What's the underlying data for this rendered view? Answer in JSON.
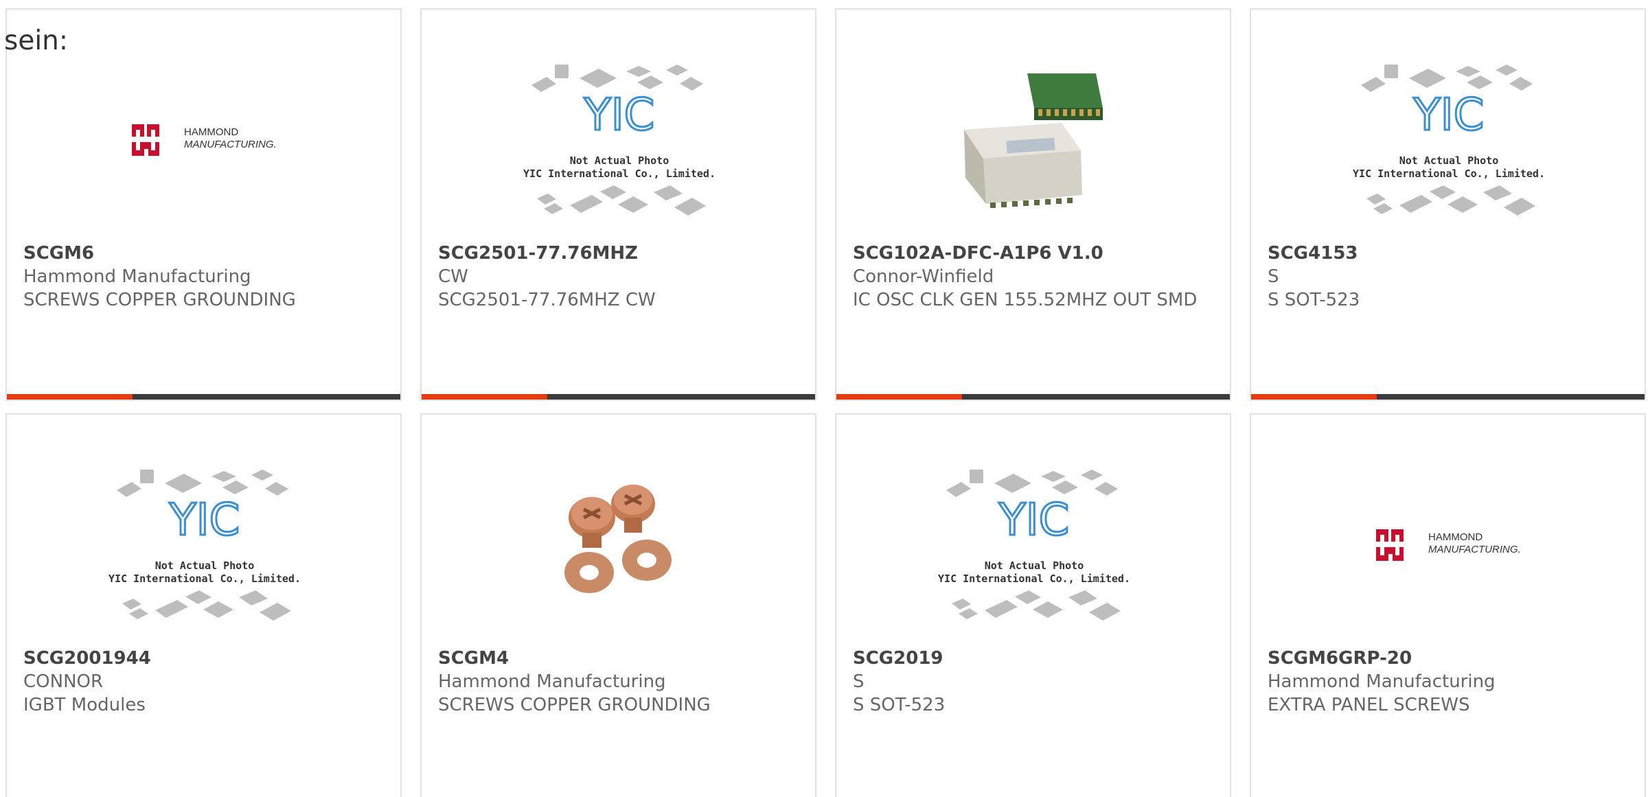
{
  "intro": {
    "text": "sein:"
  },
  "colors": {
    "accent": "#e23d12",
    "bar": "#3b3b3b",
    "logo_red": "#c8102e",
    "yic_blue": "#3a8fd0"
  },
  "products": [
    {
      "part": "SCGM6",
      "manufacturer": "Hammond Manufacturing",
      "description": "SCREWS COPPER GROUNDING",
      "image": "hammond-logo",
      "logo_text": {
        "line1": "HAMMOND",
        "line2": "MANUFACTURING."
      }
    },
    {
      "part": "SCG2501-77.76MHZ",
      "manufacturer": "CW",
      "description": "SCG2501-77.76MHZ CW",
      "image": "yic-placeholder",
      "placeholder_text": {
        "line1": "Not Actual Photo",
        "line2": "YIC International Co., Limited.",
        "logo": "YIC"
      }
    },
    {
      "part": "SCG102A-DFC-A1P6 V1.0",
      "manufacturer": "Connor-Winfield",
      "description": "IC OSC CLK GEN 155.52MHZ OUT SMD",
      "image": "oscillator-photo"
    },
    {
      "part": "SCG4153",
      "manufacturer": "S",
      "description": "S SOT-523",
      "image": "yic-placeholder",
      "placeholder_text": {
        "line1": "Not Actual Photo",
        "line2": "YIC International Co., Limited.",
        "logo": "YIC"
      }
    },
    {
      "part": "SCG2001944",
      "manufacturer": "CONNOR",
      "description": "IGBT Modules",
      "image": "yic-placeholder",
      "placeholder_text": {
        "line1": "Not Actual Photo",
        "line2": "YIC International Co., Limited.",
        "logo": "YIC"
      }
    },
    {
      "part": "SCGM4",
      "manufacturer": "Hammond Manufacturing",
      "description": "SCREWS COPPER GROUNDING",
      "image": "copper-screws-photo"
    },
    {
      "part": "SCG2019",
      "manufacturer": "S",
      "description": "S SOT-523",
      "image": "yic-placeholder",
      "placeholder_text": {
        "line1": "Not Actual Photo",
        "line2": "YIC International Co., Limited.",
        "logo": "YIC"
      }
    },
    {
      "part": "SCGM6GRP-20",
      "manufacturer": "Hammond Manufacturing",
      "description": "EXTRA PANEL SCREWS",
      "image": "hammond-logo",
      "logo_text": {
        "line1": "HAMMOND",
        "line2": "MANUFACTURING."
      }
    }
  ]
}
